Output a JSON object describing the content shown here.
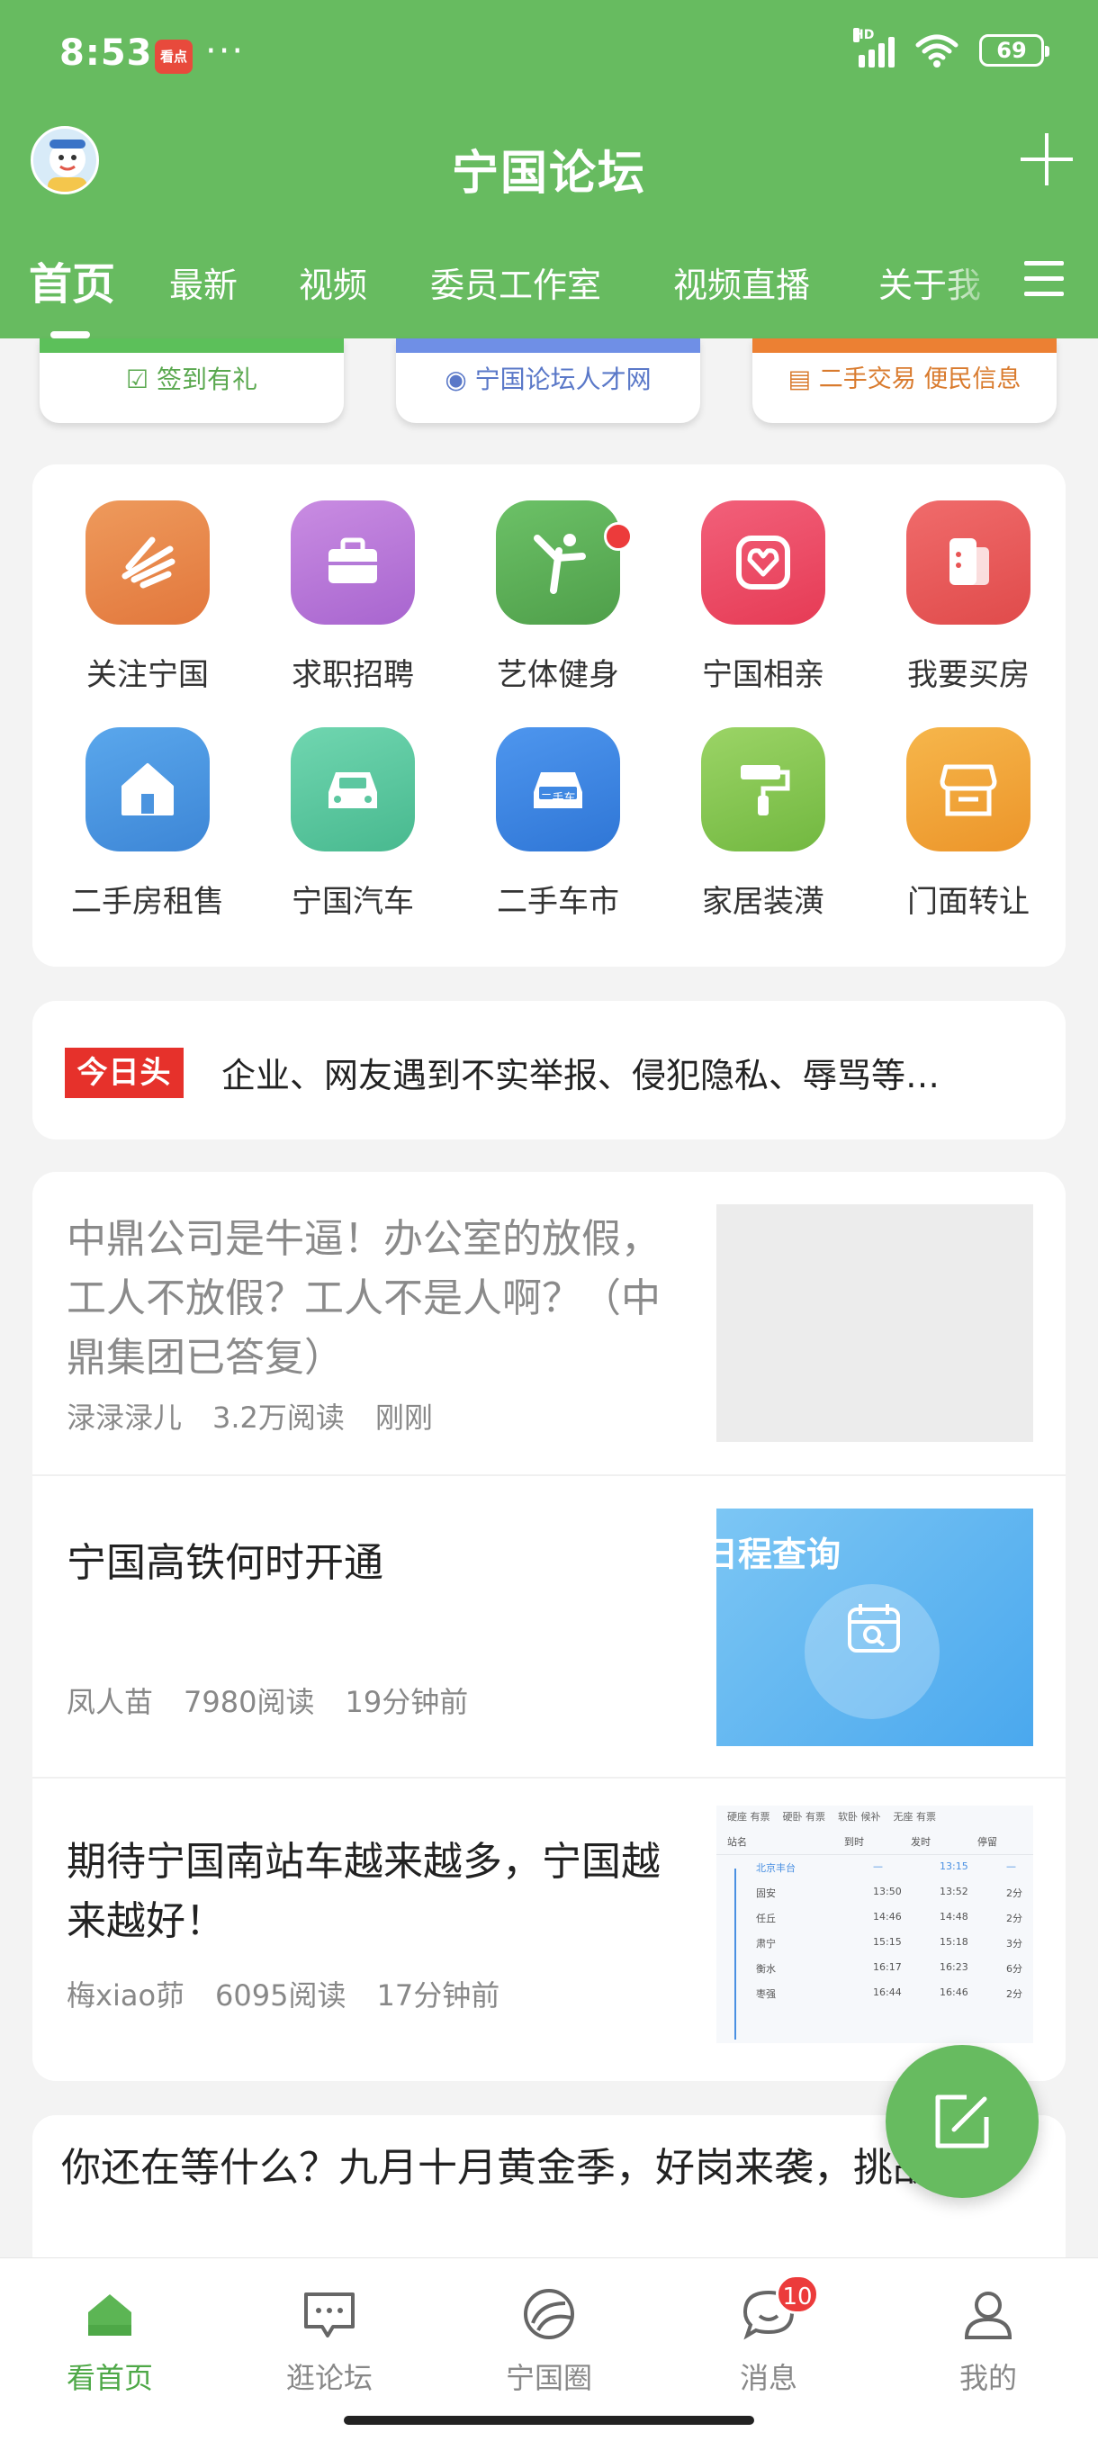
{
  "status_bar": {
    "time": "8:53",
    "app_badge": "看点",
    "dots": "···",
    "network": "HD",
    "battery": "69"
  },
  "header": {
    "title": "宁国论坛"
  },
  "tabs": [
    "首页",
    "最新",
    "视频",
    "委员工作室",
    "视频直播",
    "关于我"
  ],
  "promos": [
    {
      "label": "签到有礼",
      "color": "#5cc05a",
      "text_color": "#5aa84f"
    },
    {
      "label": "宁国论坛人才网",
      "color": "#6f8fe6",
      "text_color": "#5a78c8"
    },
    {
      "label": "二手交易 便民信息",
      "color": "#ec8033",
      "text_color": "#d97b2e"
    }
  ],
  "grid": [
    {
      "label": "关注宁国",
      "icon": "leaf-icon",
      "color": "#e88c4c"
    },
    {
      "label": "求职招聘",
      "icon": "briefcase-icon",
      "color": "#b97ad8"
    },
    {
      "label": "艺体健身",
      "icon": "fitness-icon",
      "color": "#5bb057"
    },
    {
      "label": "宁国相亲",
      "icon": "heart-icon",
      "color": "#ec4b63"
    },
    {
      "label": "我要买房",
      "icon": "house-card-icon",
      "color": "#ea5a5a"
    },
    {
      "label": "二手房租售",
      "icon": "home-icon",
      "color": "#4c97e0"
    },
    {
      "label": "宁国汽车",
      "icon": "car-icon",
      "color": "#58c8a0"
    },
    {
      "label": "二手车市",
      "icon": "used-car-icon",
      "color": "#3f88e2"
    },
    {
      "label": "家居装潢",
      "icon": "paint-roller-icon",
      "color": "#86c653"
    },
    {
      "label": "门面转让",
      "icon": "storefront-icon",
      "color": "#f0a53a"
    }
  ],
  "used_car_tag": "二手车",
  "headline": {
    "logo": "今日头条",
    "text": "企业、网友遇到不实举报、侵犯隐私、辱骂等…"
  },
  "feed": [
    {
      "title": "中鼎公司是牛逼！办公室的放假，工人不放假？工人不是人啊？（中鼎集团已答复）",
      "author": "渌渌渌儿",
      "reads": "3.2万阅读",
      "time": "刚刚"
    },
    {
      "title": "宁国高铁何时开通",
      "author": "凤人苗",
      "reads": "7980阅读",
      "time": "19分钟前",
      "thumb_text": "日程查询"
    },
    {
      "title": "期待宁国南站车越来越多，宁国越来越好！",
      "author": "梅xiao茆",
      "reads": "6095阅读",
      "time": "17分钟前"
    }
  ],
  "train_table": {
    "tabs": [
      "硬座 有票",
      "硬卧 有票",
      "软卧 候补",
      "无座 有票"
    ],
    "headers": [
      "站名",
      "到时",
      "发时",
      "停留"
    ],
    "rows": [
      [
        "北京丰台",
        "—",
        "13:15",
        "—"
      ],
      [
        "固安",
        "13:50",
        "13:52",
        "2分"
      ],
      [
        "任丘",
        "14:46",
        "14:48",
        "2分"
      ],
      [
        "肃宁",
        "15:15",
        "15:18",
        "3分"
      ],
      [
        "衡水",
        "16:17",
        "16:23",
        "6分"
      ],
      [
        "枣强",
        "16:44",
        "16:46",
        "2分"
      ]
    ]
  },
  "partial_post": {
    "title": "你还在等什么？九月十月黄金季，好岗来袭，挑战!"
  },
  "bottom_nav": [
    {
      "label": "看首页",
      "icon": "home-icon"
    },
    {
      "label": "逛论坛",
      "icon": "chat-box-icon"
    },
    {
      "label": "宁国圈",
      "icon": "circle-icon"
    },
    {
      "label": "消息",
      "icon": "message-icon",
      "badge": "10"
    },
    {
      "label": "我的",
      "icon": "user-icon"
    }
  ]
}
